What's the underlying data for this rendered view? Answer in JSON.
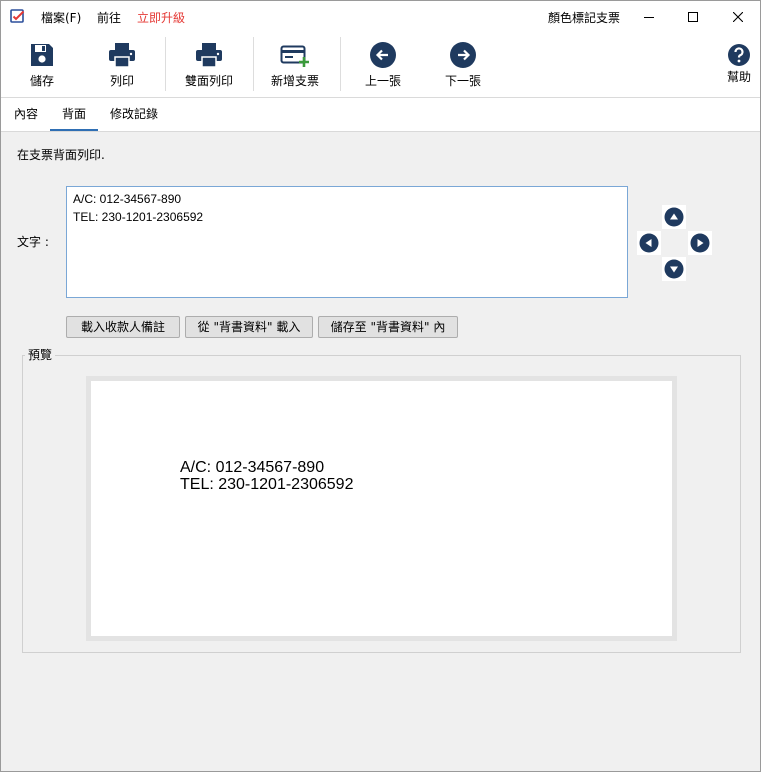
{
  "menubar": {
    "file": "檔案(F)",
    "go": "前往",
    "upgrade": "立即升級",
    "window_title": "顏色標記支票"
  },
  "toolbar": {
    "save": "儲存",
    "print": "列印",
    "duplex_print": "雙面列印",
    "new_check": "新增支票",
    "prev": "上一張",
    "next": "下一張",
    "help": "幫助"
  },
  "tabs": [
    {
      "label": "內容"
    },
    {
      "label": "背面"
    },
    {
      "label": "修改記錄"
    }
  ],
  "content": {
    "description": "在支票背面列印.",
    "text_label": "文字 :",
    "text_lines": [
      "A/C: 012-34567-890",
      "TEL: 230-1201-2306592"
    ],
    "buttons": {
      "load_payee": "載入收款人備註",
      "load_from": "從 \"背書資料\" 載入",
      "save_to": "儲存至 \"背書資料\" 內"
    },
    "preview_label": "預覽"
  },
  "icons": {
    "accent": "#1f3a5f",
    "new_check_plus": "#3a9a3a",
    "upgrade_color": "#e53935"
  }
}
